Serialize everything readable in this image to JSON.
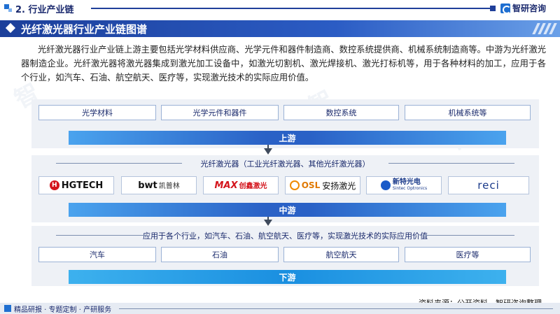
{
  "header": {
    "section_title": "2. 行业产业链",
    "logo_text": "智研咨询"
  },
  "title": "光纤激光器行业产业链图谱",
  "intro": "光纤激光器行业产业链上游主要包括光学材料供应商、光学元件和器件制造商、数控系统提供商、机械系统制造商等。中游为光纤激光器制造企业。光纤激光器将激光器集成到激光加工设备中，如激光切割机、激光焊接机、激光打标机等，用于各种材料的加工，应用于各个行业，如汽车、石油、航空航天、医疗等，实现激光技术的实际应用价值。",
  "upstream": {
    "items": [
      "光学材料",
      "光学元件和器件",
      "数控系统",
      "机械系统等"
    ],
    "label": "上游"
  },
  "midstream": {
    "heading": "光纤激光器（工业光纤激光器、其他光纤激光器）",
    "companies": {
      "hgtech": "HGTECH",
      "bwt_brand": "bwt",
      "bwt_cn": "凯普林",
      "max_brand": "MAX",
      "max_cn": "创鑫激光",
      "osl_brand": "OSL",
      "osl_cn": "安扬激光",
      "sintec_cn": "新特光电",
      "sintec_en": "Sintec Optronics",
      "reci": "reci"
    },
    "label": "中游"
  },
  "downstream": {
    "heading": "应用于各个行业，如汽车、石油、航空航天、医疗等，实现激光技术的实际应用价值",
    "items": [
      "汽车",
      "石油",
      "航空航天",
      "医疗等"
    ],
    "label": "下游"
  },
  "source": "资料来源：公开资料、智研咨询整理",
  "footer": "精品研报 · 专题定制 · 产研服务",
  "colors": {
    "brand_dark": "#1b2a6e",
    "brand_blue": "#2a61c6",
    "panel_bg": "#eef1f6",
    "box_border": "#9bb2d6"
  }
}
